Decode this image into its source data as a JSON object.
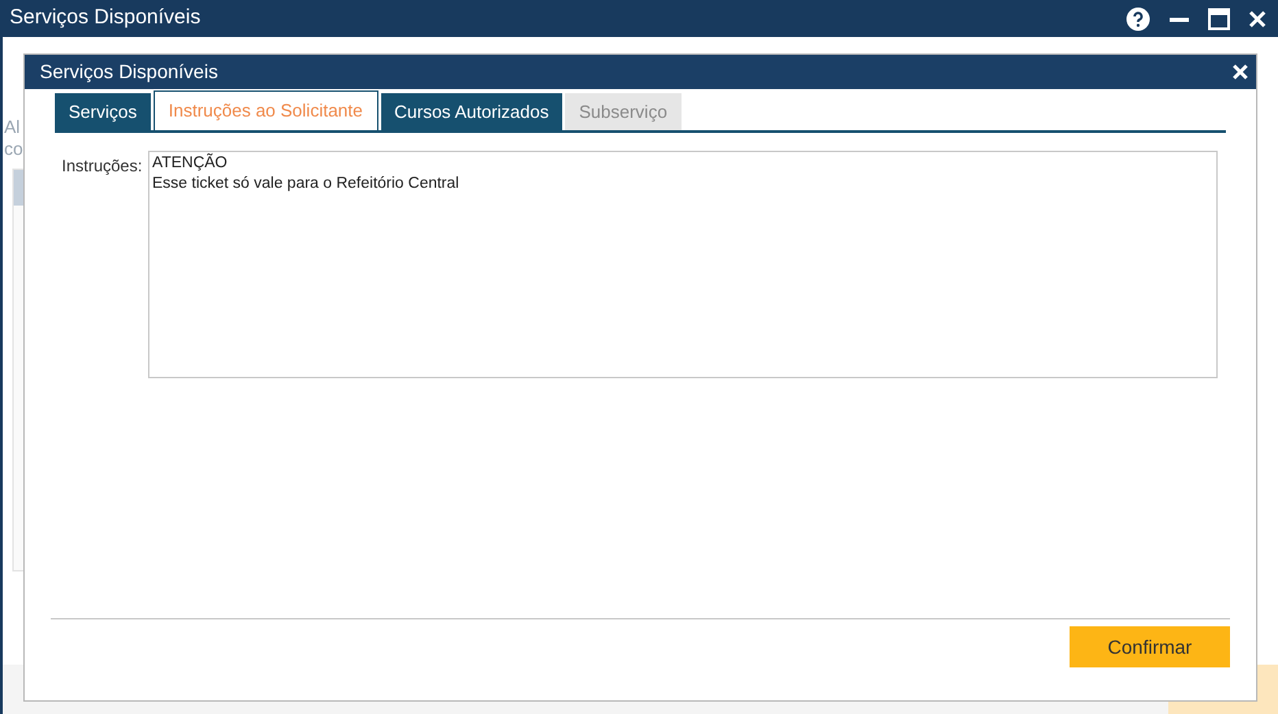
{
  "window": {
    "title": "Serviços Disponíveis"
  },
  "background": {
    "fragments": [
      "Al",
      "co"
    ]
  },
  "dialog": {
    "title": "Serviços Disponíveis",
    "tabs": [
      {
        "label": "Serviços",
        "selected": false,
        "disabled": false
      },
      {
        "label": "Instruções ao Solicitante",
        "selected": true,
        "disabled": false
      },
      {
        "label": "Cursos Autorizados",
        "selected": false,
        "disabled": false
      },
      {
        "label": "Subserviço",
        "selected": false,
        "disabled": true
      }
    ],
    "instructions": {
      "label": "Instruções:",
      "value": "ATENÇÃO\nEsse ticket só vale para o Refeitório Central"
    },
    "buttons": [
      "Confirmar"
    ]
  }
}
